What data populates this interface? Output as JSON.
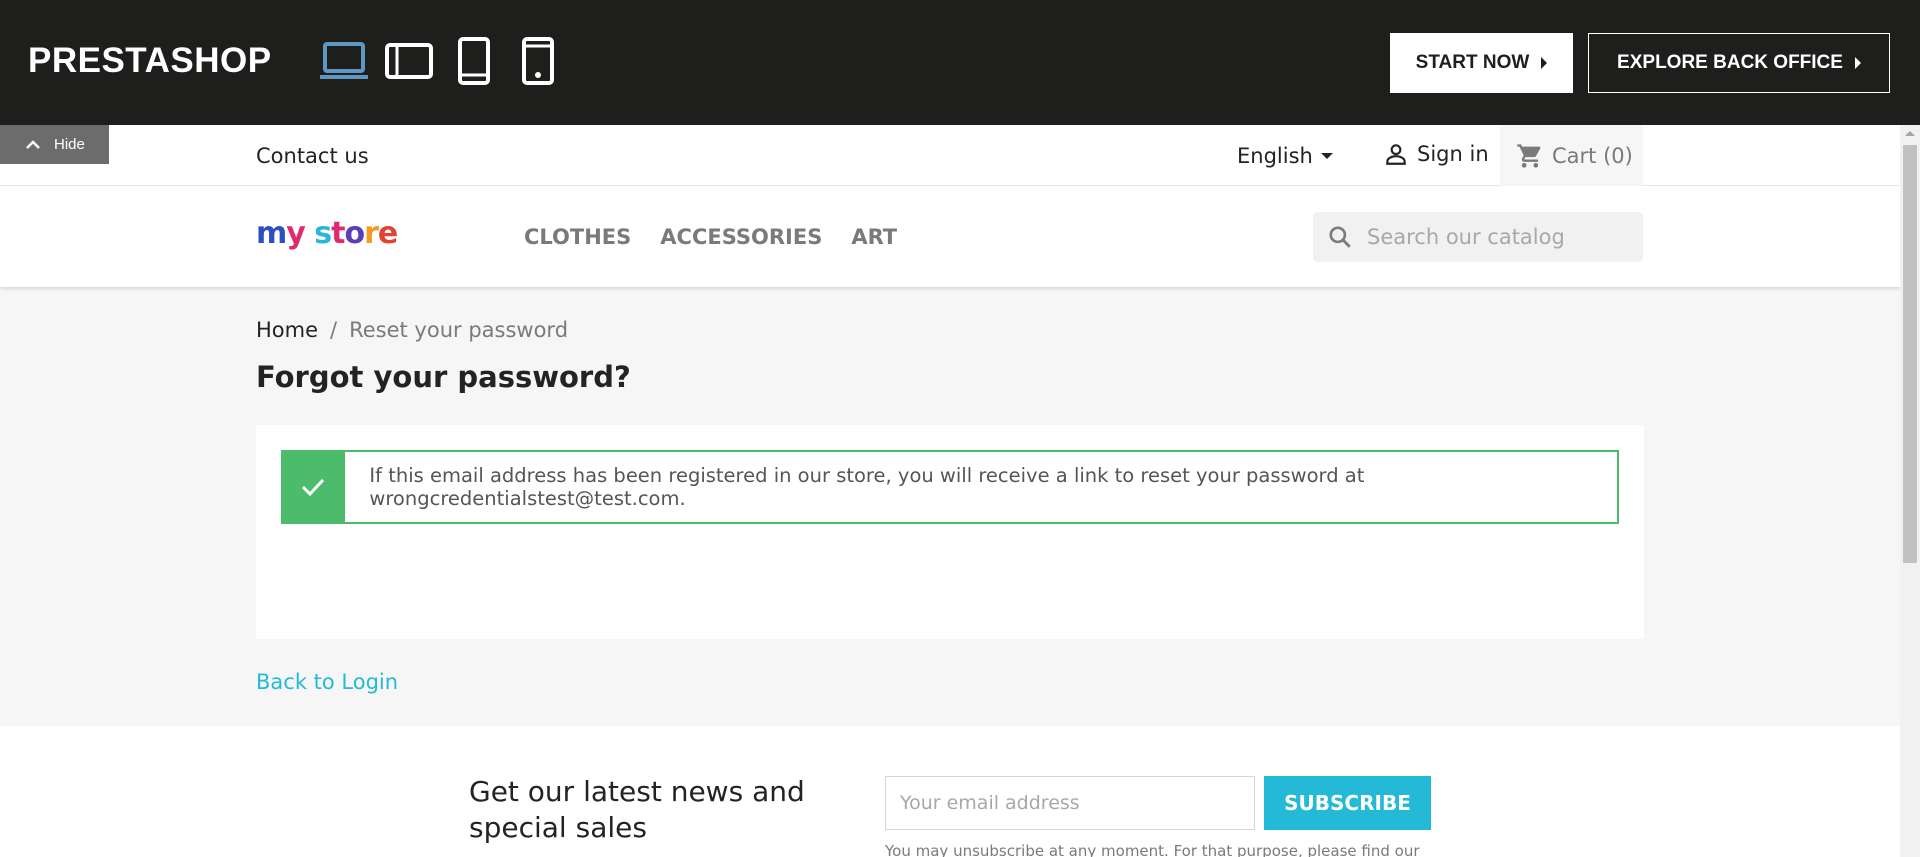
{
  "demo_bar": {
    "brand": "PRESTASHOP",
    "devices": [
      "laptop-icon",
      "tablet-landscape-icon",
      "tablet-portrait-icon",
      "mobile-icon"
    ],
    "start_now": "START NOW",
    "explore": "EXPLORE BACK OFFICE",
    "hide": "Hide"
  },
  "header": {
    "contact": "Contact us",
    "language": "English",
    "sign_in": "Sign in",
    "cart": "Cart (0)",
    "logo": "my store",
    "menu": [
      "CLOTHES",
      "ACCESSORIES",
      "ART"
    ],
    "search_placeholder": "Search our catalog"
  },
  "breadcrumb": {
    "home": "Home",
    "separator": "/",
    "current": "Reset your password"
  },
  "main": {
    "title": "Forgot your password?",
    "alert_text": "If this email address has been registered in our store, you will receive a link to reset your password at wrongcredentialstest@test.com.",
    "back_to_login": "Back to Login"
  },
  "newsletter": {
    "title": "Get our latest news and special sales",
    "email_placeholder": "Your email address",
    "subscribe": "SUBSCRIBE",
    "note": "You may unsubscribe at any moment. For that purpose, please find our"
  },
  "colors": {
    "demo_bar_bg": "#1e1e1d",
    "accent": "#24b9d7",
    "success": "#4cbb6c",
    "active_device": "#5e97c2"
  }
}
